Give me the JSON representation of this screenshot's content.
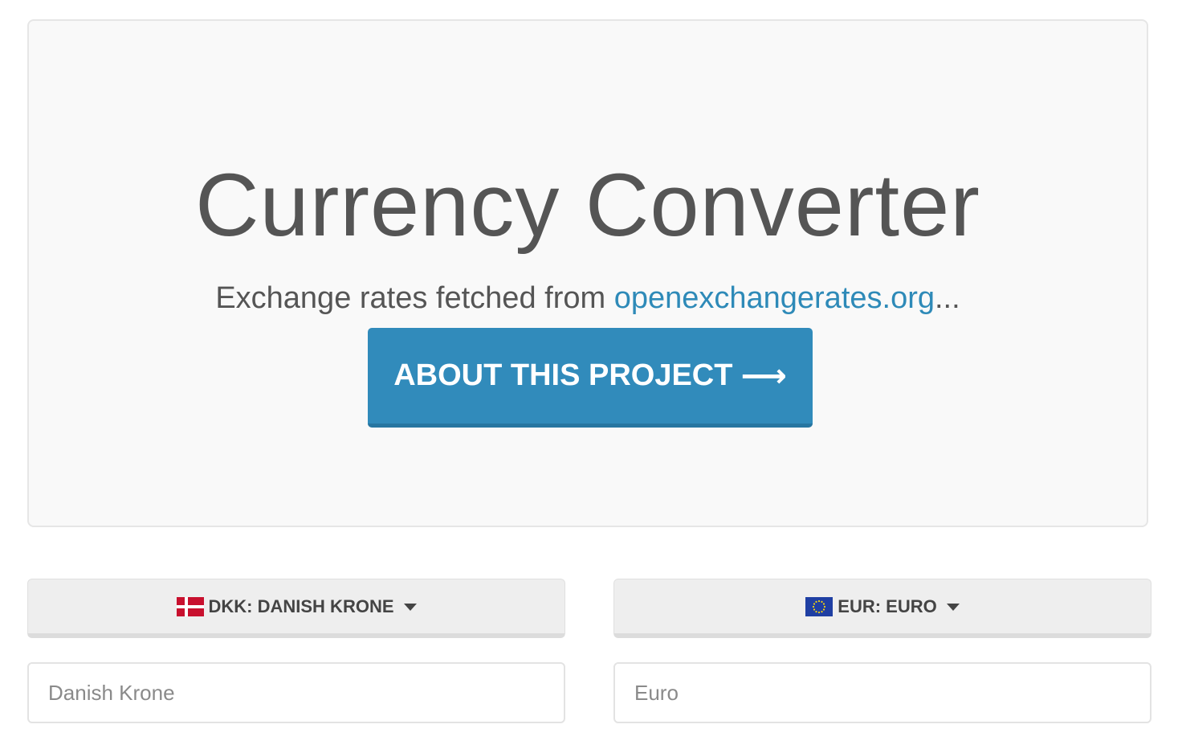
{
  "hero": {
    "title": "Currency Converter",
    "subtitle_prefix": "Exchange rates fetched from ",
    "subtitle_link": "openexchangerates.org",
    "subtitle_suffix": "...",
    "about_button_label": "ABOUT THIS PROJECT",
    "about_button_icon": "arrow-right-icon"
  },
  "converter": {
    "from": {
      "flag_icon": "denmark-flag-icon",
      "label": "DKK: DANISH KRONE",
      "input_placeholder": "Danish Krone",
      "input_value": ""
    },
    "to": {
      "flag_icon": "eu-flag-icon",
      "label": "EUR: EURO",
      "input_placeholder": "Euro",
      "input_value": ""
    }
  },
  "colors": {
    "accent": "#318bbb",
    "link": "#2e8ab8",
    "hero_bg": "#f9f9f9",
    "text": "#555555"
  }
}
